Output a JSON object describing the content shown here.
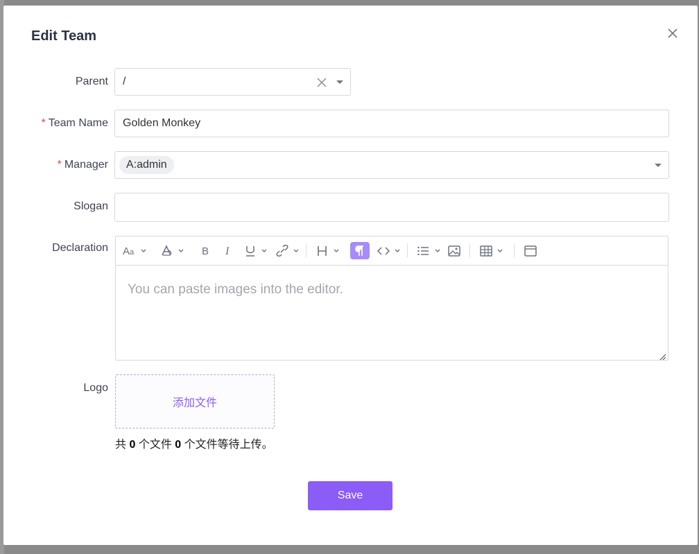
{
  "modal": {
    "title": "Edit Team"
  },
  "form": {
    "parent": {
      "label": "Parent",
      "value": "/"
    },
    "team_name": {
      "label": "Team Name",
      "required_mark": "*",
      "value": "Golden Monkey"
    },
    "manager": {
      "label": "Manager",
      "required_mark": "*",
      "tags": [
        "A:admin"
      ]
    },
    "slogan": {
      "label": "Slogan",
      "value": ""
    },
    "declaration": {
      "label": "Declaration",
      "placeholder": "You can paste images into the editor.",
      "toolbar": [
        "font-size-icon",
        "text-color-icon",
        "bold-icon",
        "italic-icon",
        "underline-icon",
        "link-icon",
        "heading-icon",
        "paragraph-icon",
        "code-icon",
        "list-icon",
        "image-icon",
        "table-icon",
        "fullscreen-icon"
      ]
    },
    "logo": {
      "label": "Logo",
      "add_file_label": "添加文件",
      "summary_prefix": "共",
      "total_count": "0",
      "summary_middle": "个文件",
      "pending_count": "0",
      "summary_suffix": "个文件等待上传。"
    }
  },
  "actions": {
    "save_label": "Save"
  },
  "colors": {
    "accent": "#8b5cf6",
    "required": "#e5483a",
    "active_tool": "#a78bfa"
  }
}
